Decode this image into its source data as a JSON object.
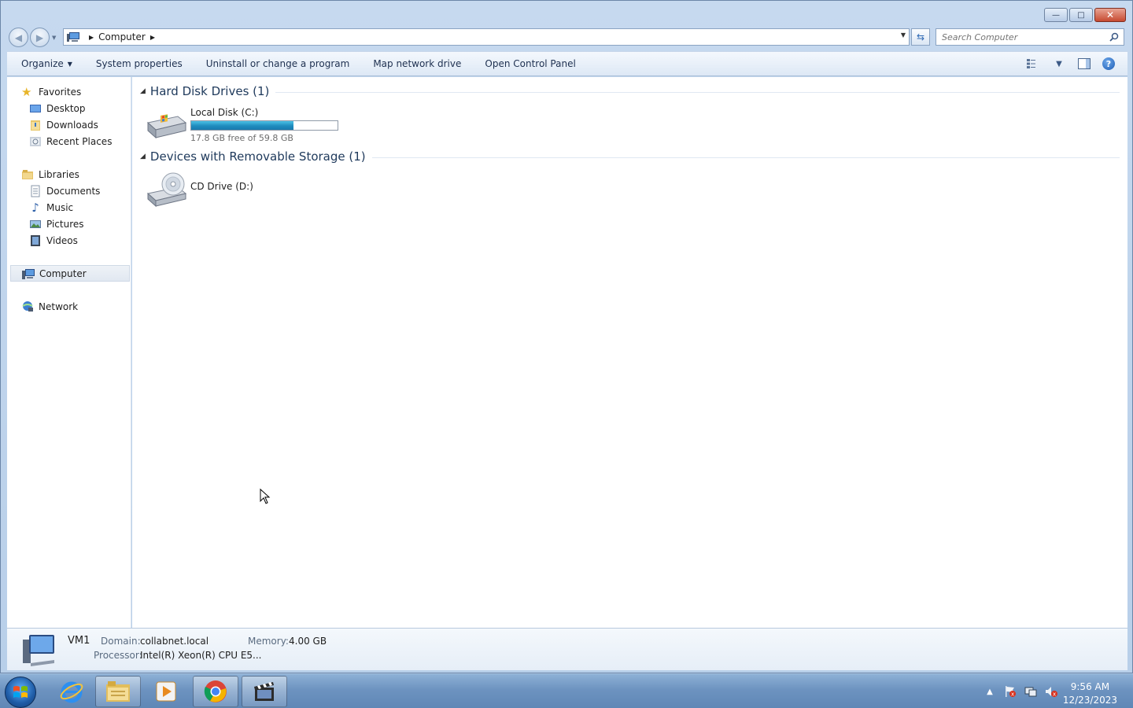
{
  "window": {
    "controls": {
      "minimize": "—",
      "maximize": "□",
      "close": "✕"
    }
  },
  "address": {
    "breadcrumb": [
      "Computer"
    ],
    "search_placeholder": "Search Computer"
  },
  "toolbar": {
    "organize": "Organize",
    "system_properties": "System properties",
    "uninstall": "Uninstall or change a program",
    "map_drive": "Map network drive",
    "control_panel": "Open Control Panel"
  },
  "nav": {
    "favorites": "Favorites",
    "desktop": "Desktop",
    "downloads": "Downloads",
    "recent": "Recent Places",
    "libraries": "Libraries",
    "documents": "Documents",
    "music": "Music",
    "pictures": "Pictures",
    "videos": "Videos",
    "computer": "Computer",
    "network": "Network"
  },
  "groups": {
    "hdd": "Hard Disk Drives (1)",
    "removable": "Devices with Removable Storage (1)"
  },
  "drives": {
    "c": {
      "name": "Local Disk (C:)",
      "free": "17.8 GB free of 59.8 GB",
      "used_fraction": 0.7
    },
    "d": {
      "name": "CD Drive (D:)"
    }
  },
  "details": {
    "name": "VM1",
    "domain_label": "Domain:",
    "domain": "collabnet.local",
    "memory_label": "Memory:",
    "memory": "4.00 GB",
    "processor_label": "Processor:",
    "processor": "Intel(R) Xeon(R) CPU E5..."
  },
  "taskbar": {
    "time": "9:56 AM",
    "date": "12/23/2023"
  },
  "colors": {
    "accent_title": "#1e395b",
    "disk_bar": "#26a0da"
  }
}
